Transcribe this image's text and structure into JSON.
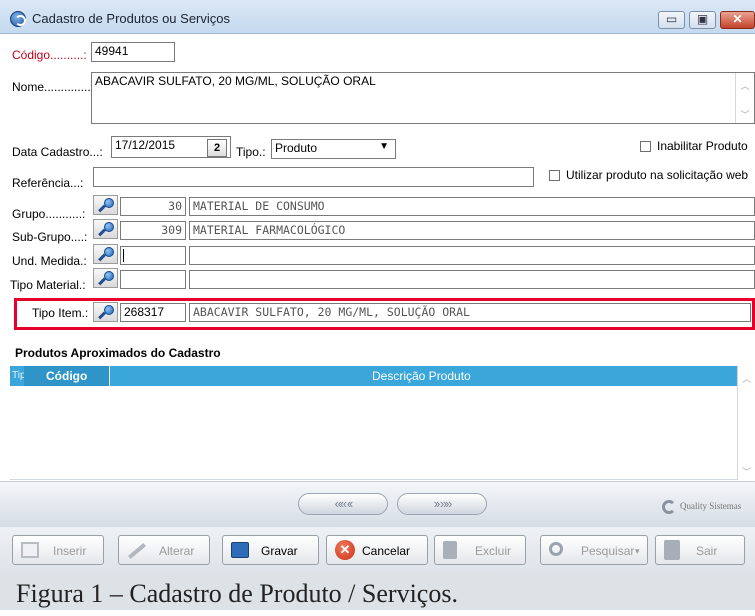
{
  "window": {
    "title": "Cadastro de Produtos ou Serviços",
    "buttons": {
      "minimize": "▭",
      "maximize": "▣",
      "close": "✕"
    }
  },
  "form": {
    "codigo": {
      "label": "Código..........:",
      "value": "49941"
    },
    "nome": {
      "label": "Nome..............:",
      "value": "ABACAVIR SULFATO, 20 MG/ML, SOLUÇÃO ORAL"
    },
    "data_cadastro": {
      "label": "Data Cadastro...:",
      "value": "17/12/2015",
      "calendar_day": "2"
    },
    "tipo": {
      "label": "Tipo.:",
      "value": "Produto"
    },
    "inabilitar": {
      "label": "Inabilitar Produto"
    },
    "referencia": {
      "label": "Referência...:",
      "value": ""
    },
    "utilizar": {
      "label": "Utilizar produto na solicitação web"
    },
    "grupo": {
      "label": "Grupo...........:",
      "code": "30",
      "description": "MATERIAL DE CONSUMO"
    },
    "sub_grupo": {
      "label": "Sub-Grupo....:",
      "code": "309",
      "description": "MATERIAL FARMACOLÓGICO"
    },
    "und_medida": {
      "label": "Und. Medida.:",
      "code": "",
      "description": ""
    },
    "tipo_material": {
      "label": "Tipo Material.:",
      "code": "",
      "description": ""
    },
    "tipo_item": {
      "label": "Tipo Item.:",
      "code": "268317",
      "description": "ABACAVIR SULFATO, 20 MG/ML, SOLUÇÃO ORAL"
    }
  },
  "grid": {
    "title": "Produtos Aproximados do Cadastro",
    "columns": {
      "tip": "Tip",
      "codigo": "Código",
      "descricao": "Descrição Produto"
    },
    "rows": []
  },
  "nav": {
    "first_prev": "«« ‹‹",
    "next_last": "›› »»",
    "brand": "Quality Sistemas"
  },
  "toolbar": {
    "inserir": "Inserir",
    "alterar": "Alterar",
    "gravar": "Gravar",
    "cancelar": "Cancelar",
    "excluir": "Excluir",
    "pesquisar": "Pesquisar",
    "sair": "Sair"
  },
  "caption": "Figura 1 – Cadastro de Produto / Serviços.",
  "colors": {
    "highlight": "#e4002b",
    "grid_header": "#3aa6d9",
    "required_label": "#c0001a"
  }
}
